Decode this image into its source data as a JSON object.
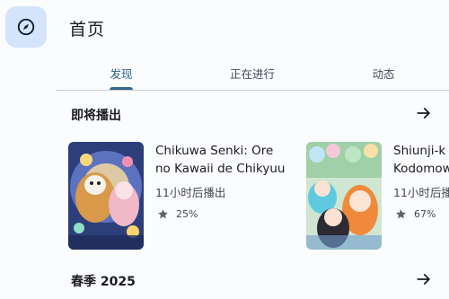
{
  "header": {
    "title": "首页",
    "nav_icon": "compass-icon"
  },
  "tabs": [
    {
      "label": "发现",
      "active": true
    },
    {
      "label": "正在进行",
      "active": false
    },
    {
      "label": "动态",
      "active": false
    }
  ],
  "sections": [
    {
      "title": "即将播出",
      "action_icon": "arrow-right-icon",
      "items": [
        {
          "title_line1": "Chikuwa Senki: Ore",
          "title_line2": "no Kawaii de Chikyuu",
          "airing": "11小时后播出",
          "score": "25%"
        },
        {
          "title_line1": "Shiunji-k",
          "title_line2": "Kodomow",
          "airing": "11小时后播",
          "score": "67%"
        }
      ]
    },
    {
      "title": "春季 2025",
      "action_icon": "arrow-right-icon"
    }
  ],
  "colors": {
    "accent": "#2e6289",
    "nav_button_bg": "#d3e4fb",
    "background": "#fbfcfe"
  }
}
